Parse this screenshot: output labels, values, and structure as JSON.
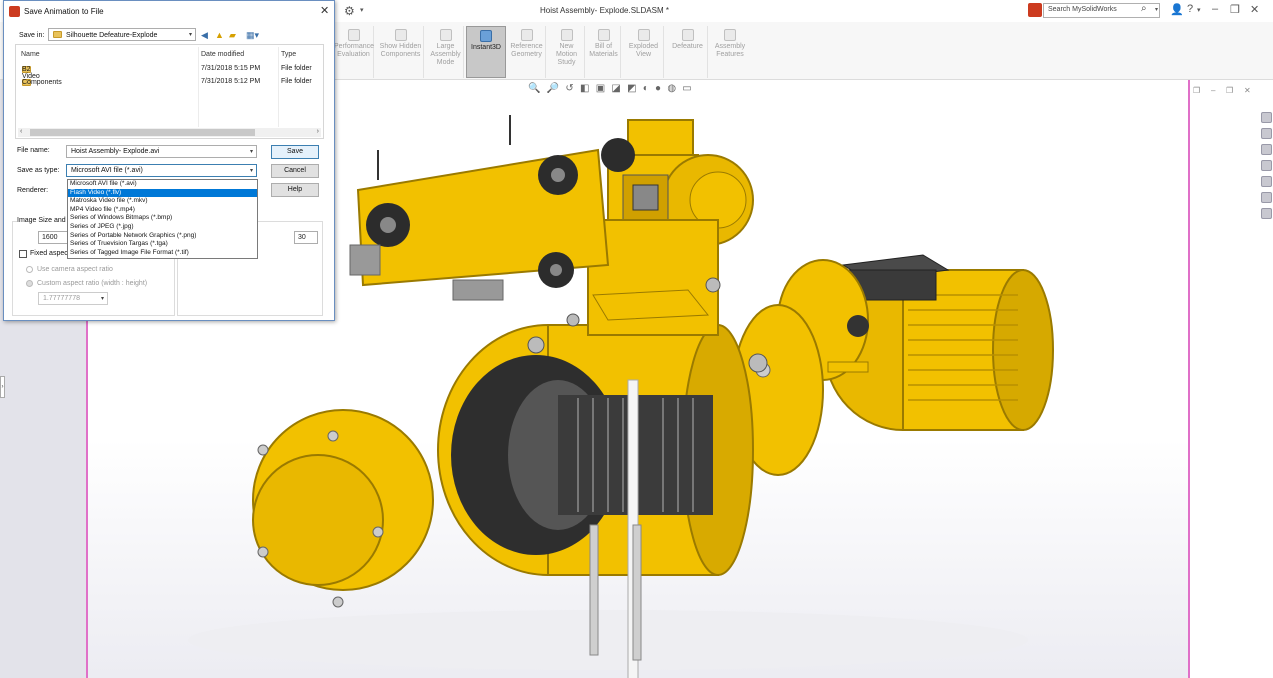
{
  "window": {
    "title": "Hoist Assembly- Explode.SLDASM *",
    "search_placeholder": "Search MySolidWorks"
  },
  "ribbon": {
    "commands": [
      {
        "label": "Performance Evaluation"
      },
      {
        "label": "Show Hidden Components"
      },
      {
        "label": "Large Assembly Mode"
      },
      {
        "label": "Instant3D"
      },
      {
        "label": "Reference Geometry"
      },
      {
        "label": "New Motion Study"
      },
      {
        "label": "Bill of Materials"
      },
      {
        "label": "Exploded View"
      },
      {
        "label": "Defeature"
      },
      {
        "label": "Assembly Features"
      }
    ]
  },
  "dialog": {
    "title": "Save Animation to File",
    "save_in_label": "Save in:",
    "save_in_value": "Silhouette Defeature-Explode",
    "columns": {
      "name": "Name",
      "date": "Date modified",
      "type": "Type"
    },
    "files": [
      {
        "name": "B2 Video",
        "date": "7/31/2018 5:15 PM",
        "type": "File folder"
      },
      {
        "name": "Components",
        "date": "7/31/2018 5:12 PM",
        "type": "File folder"
      }
    ],
    "file_name_label": "File name:",
    "file_name_value": "Hoist Assembly- Explode.avi",
    "save_as_type_label": "Save as type:",
    "save_as_type_value": "Microsoft AVI file (*.avi)",
    "renderer_label": "Renderer:",
    "buttons": {
      "save": "Save",
      "cancel": "Cancel",
      "help": "Help"
    },
    "type_options": [
      "Microsoft AVI file (*.avi)",
      "Flash Video (*.flv)",
      "Matroska Video file (*.mkv)",
      "MP4 Video file (*.mp4)",
      "Series of Windows Bitmaps (*.bmp)",
      "Series of JPEG (*.jpg)",
      "Series of Portable Network Graphics (*.png)",
      "Series of Truevision Targas (*.tga)",
      "Series of Tagged Image File Format (*.tif)"
    ],
    "image_size_label": "Image Size and",
    "width_value": "1600",
    "frames_value": "30",
    "fixed_aspect_label": "Fixed aspec",
    "camera_aspect_label": "Use camera aspect ratio",
    "custom_aspect_label": "Custom aspect ratio (width : height)",
    "aspect_value": "1.77777778"
  },
  "colors": {
    "model_yellow": "#f2c100",
    "model_dark": "#3a3a3a",
    "selection_blue": "#0078d7",
    "viewport_border": "#e070c8"
  }
}
